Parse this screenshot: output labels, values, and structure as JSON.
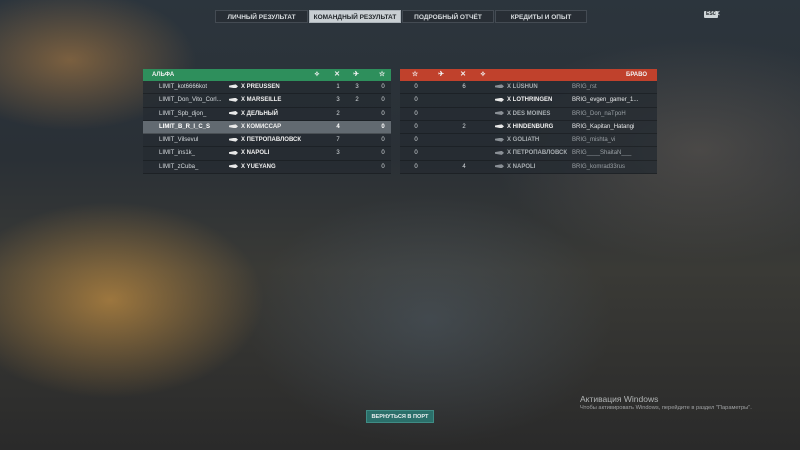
{
  "tabs": [
    {
      "label": "ЛИЧНЫЙ РЕЗУЛЬТАТ",
      "active": false
    },
    {
      "label": "КОМАНДНЫЙ РЕЗУЛЬТАТ",
      "active": true
    },
    {
      "label": "ПОДРОБНЫЙ ОТЧЁТ",
      "active": false
    },
    {
      "label": "КРЕДИТЫ И ОПЫТ",
      "active": false
    }
  ],
  "esc": {
    "key": "ESC",
    "close": "✕"
  },
  "team_alpha": {
    "name": "АЛЬФА",
    "color": "#2e8f5c",
    "column_icons": [
      "laurel-icon",
      "crossed-swords-icon",
      "plane-icon",
      "star-icon"
    ],
    "players": [
      {
        "name": "LIMIT_kot6666kot",
        "ship": "X PREUSSEN",
        "c1": "",
        "c2": "1",
        "c3": "3",
        "c4": "0",
        "selected": false
      },
      {
        "name": "LIMIT_Don_Vito_Corl...",
        "ship": "X MARSEILLE",
        "c1": "",
        "c2": "3",
        "c3": "2",
        "c4": "0",
        "selected": false
      },
      {
        "name": "LIMIT_Spb_djon_",
        "ship": "X ДЕЛЬНЫЙ",
        "c1": "",
        "c2": "2",
        "c3": "",
        "c4": "0",
        "selected": false
      },
      {
        "name": "LIMIT_B_R_I_C_S",
        "ship": "X КОМИССАР",
        "c1": "",
        "c2": "4",
        "c3": "",
        "c4": "0",
        "selected": true
      },
      {
        "name": "LIMIT_Vilsevul",
        "ship": "X ПЕТРОПАВЛОВСК",
        "c1": "",
        "c2": "7",
        "c3": "",
        "c4": "0",
        "selected": false
      },
      {
        "name": "LIMIT_ins1k_",
        "ship": "X NAPOLI",
        "c1": "",
        "c2": "3",
        "c3": "",
        "c4": "0",
        "selected": false
      },
      {
        "name": "LIMIT_zCuba_",
        "ship": "X YUEYANG",
        "c1": "",
        "c2": "",
        "c3": "",
        "c4": "0",
        "selected": false
      }
    ]
  },
  "team_bravo": {
    "name": "БРАВО",
    "color": "#c0412c",
    "column_icons": [
      "star-icon",
      "plane-icon",
      "crossed-swords-icon",
      "laurel-icon"
    ],
    "players": [
      {
        "name": "BRIG_rst",
        "ship": "X LÜSHUN",
        "c1": "0",
        "c2": "",
        "c3": "6",
        "c4": "",
        "alive": false
      },
      {
        "name": "BRIG_evgen_gamer_1...",
        "ship": "X LOTHRINGEN",
        "c1": "0",
        "c2": "",
        "c3": "",
        "c4": "",
        "alive": true
      },
      {
        "name": "BRIG_Don_naTpoH",
        "ship": "X DES MOINES",
        "c1": "0",
        "c2": "",
        "c3": "",
        "c4": "",
        "alive": false
      },
      {
        "name": "BRIG_Kapitan_Hatangi",
        "ship": "X HINDENBURG",
        "c1": "0",
        "c2": "",
        "c3": "2",
        "c4": "",
        "alive": true
      },
      {
        "name": "BRIG_mishta_vi",
        "ship": "X GOLIATH",
        "c1": "0",
        "c2": "",
        "c3": "",
        "c4": "",
        "alive": false
      },
      {
        "name": "BRIG____ShaitaN___",
        "ship": "X ПЕТРОПАВЛОВСК",
        "c1": "0",
        "c2": "",
        "c3": "",
        "c4": "",
        "alive": false
      },
      {
        "name": "BRIG_komrad33rus",
        "ship": "X NAPOLI",
        "c1": "0",
        "c2": "",
        "c3": "4",
        "c4": "",
        "alive": false
      }
    ]
  },
  "return_button": "ВЕРНУТЬСЯ В ПОРТ",
  "watermark": {
    "title": "Активация Windows",
    "subtitle": "Чтобы активировать Windows, перейдите в раздел \"Параметры\"."
  }
}
